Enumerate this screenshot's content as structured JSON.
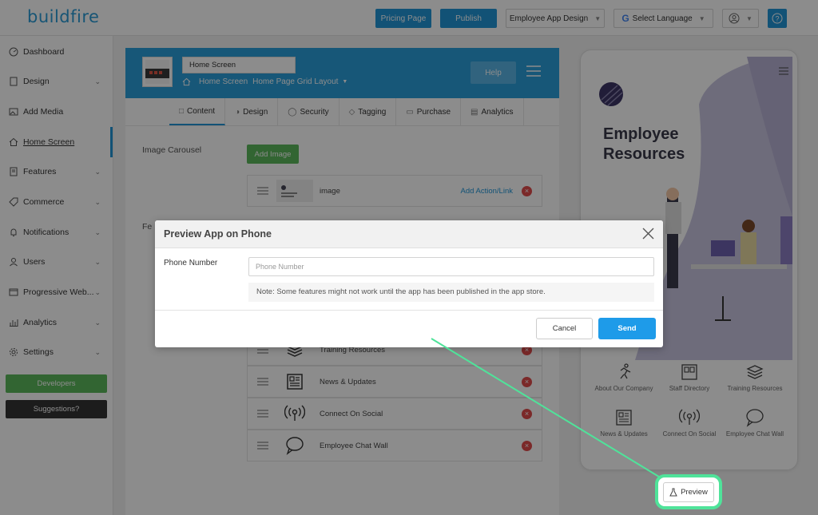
{
  "topbar": {
    "logo": "buildfire",
    "pricing_label": "Pricing Page",
    "publish_label": "Publish",
    "app_design_label": "Employee App Design",
    "language_label": "Select Language",
    "help_icon": "question-icon"
  },
  "sidebar": {
    "items": [
      {
        "label": "Dashboard",
        "icon": "dashboard-icon",
        "chevron": false
      },
      {
        "label": "Design",
        "icon": "design-icon",
        "chevron": true
      },
      {
        "label": "Add Media",
        "icon": "media-icon",
        "chevron": false
      },
      {
        "label": "Home Screen",
        "icon": "home-icon",
        "chevron": false,
        "active": true
      },
      {
        "label": "Features",
        "icon": "features-icon",
        "chevron": true
      },
      {
        "label": "Commerce",
        "icon": "tag-icon",
        "chevron": true
      },
      {
        "label": "Notifications",
        "icon": "bell-icon",
        "chevron": true
      },
      {
        "label": "Users",
        "icon": "user-icon",
        "chevron": true
      },
      {
        "label": "Progressive Web...",
        "icon": "web-icon",
        "chevron": true
      },
      {
        "label": "Analytics",
        "icon": "chart-icon",
        "chevron": true
      },
      {
        "label": "Settings",
        "icon": "gear-icon",
        "chevron": true
      }
    ],
    "developers_label": "Developers",
    "suggestions_label": "Suggestions?"
  },
  "main": {
    "screen_name": "Home Screen",
    "breadcrumb_page": "Home Screen",
    "breadcrumb_layout": "Home Page Grid Layout",
    "help_label": "Help",
    "tabs": [
      {
        "label": "Content",
        "active": true
      },
      {
        "label": "Design"
      },
      {
        "label": "Security"
      },
      {
        "label": "Tagging"
      },
      {
        "label": "Purchase"
      },
      {
        "label": "Analytics"
      }
    ],
    "image_carousel_label": "Image Carousel",
    "features_label": "Fe",
    "add_image_label": "Add Image",
    "carousel_row": {
      "label": "image",
      "action": "Add Action/Link"
    },
    "feature_rows": [
      {
        "label": "Training Resources",
        "icon": "stack-icon"
      },
      {
        "label": "News & Updates",
        "icon": "newspaper-icon"
      },
      {
        "label": "Connect On Social",
        "icon": "broadcast-icon"
      },
      {
        "label": "Employee Chat Wall",
        "icon": "chat-icon"
      }
    ]
  },
  "phone": {
    "title": "Employee Resources",
    "tiles": [
      {
        "label": "About Our Company"
      },
      {
        "label": "Staff Directory"
      },
      {
        "label": "Training Resources"
      },
      {
        "label": "News & Updates"
      },
      {
        "label": "Connect On Social"
      },
      {
        "label": "Employee Chat Wall"
      }
    ]
  },
  "modal": {
    "title": "Preview App on Phone",
    "phone_label": "Phone Number",
    "phone_placeholder": "Phone Number",
    "phone_value": "",
    "note": "Note: Some features might not work until the app has been published in the app store.",
    "cancel_label": "Cancel",
    "send_label": "Send"
  },
  "preview": {
    "label": "Preview"
  },
  "colors": {
    "accent": "#2196d8",
    "header_blue": "#2a9fdb",
    "green": "#5cb85c",
    "danger": "#e04b4b",
    "highlight": "#4fe39a",
    "send_blue": "#1e9be9"
  }
}
